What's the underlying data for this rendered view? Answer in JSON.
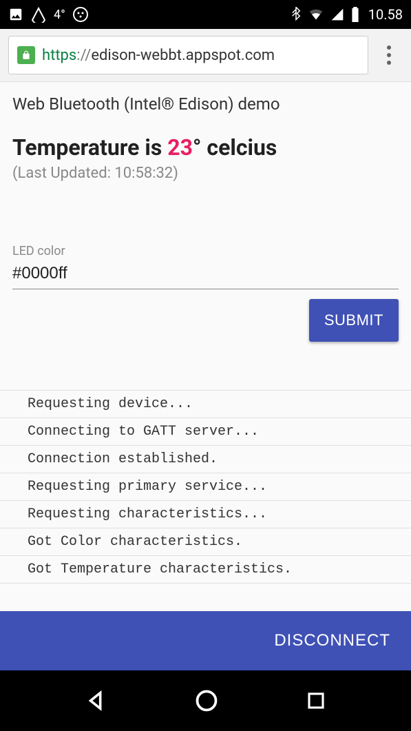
{
  "status_bar": {
    "temp": "4°",
    "time": "10.58"
  },
  "browser": {
    "scheme": "https",
    "sep": "://",
    "host": "edison-webbt.appspot.com"
  },
  "page": {
    "demo_title": "Web Bluetooth (Intel® Edison) demo",
    "temp_prefix": "Temperature is ",
    "temp_value": "23",
    "temp_suffix": "° celcius",
    "last_updated": "(Last Updated: 10:58:32)",
    "led_label": "LED color",
    "led_value": "#0000ff",
    "submit_label": "SUBMIT",
    "disconnect_label": "DISCONNECT"
  },
  "log": [
    "Requesting device...",
    "Connecting to GATT server...",
    "Connection established.",
    "Requesting primary service...",
    "Requesting characteristics...",
    "Got Color characteristics.",
    "Got Temperature characteristics."
  ]
}
